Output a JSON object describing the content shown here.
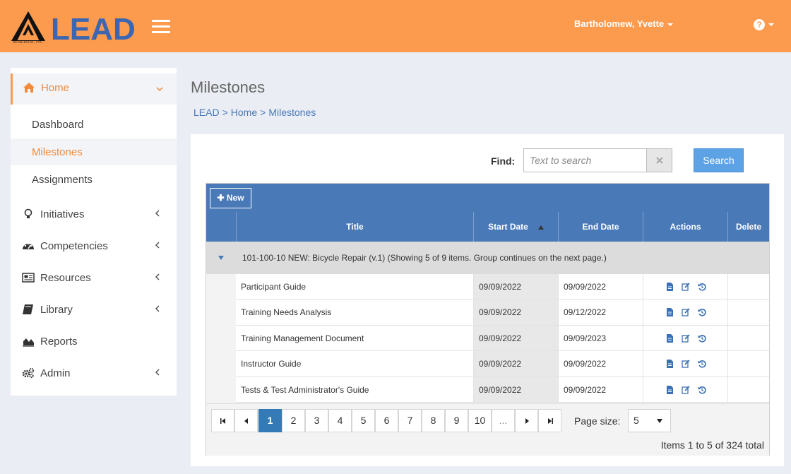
{
  "brand": {
    "logo_text": "LEAD",
    "logo_sub": "AEMERSON, INC."
  },
  "colors": {
    "header_bg": "#fc9a4d",
    "accent": "#f08a3c",
    "grid_header": "#4a79b8",
    "primary_button": "#5ea2e6"
  },
  "header": {
    "user_name": "Bartholomew, Yvette",
    "help_icon": "question-circle-icon"
  },
  "sidebar": {
    "home": {
      "label": "Home",
      "icon": "home-icon"
    },
    "sub_items": [
      {
        "label": "Dashboard"
      },
      {
        "label": "Milestones"
      },
      {
        "label": "Assignments"
      }
    ],
    "items": [
      {
        "label": "Initiatives",
        "icon": "lightbulb-icon"
      },
      {
        "label": "Competencies",
        "icon": "dashboard-icon"
      },
      {
        "label": "Resources",
        "icon": "newspaper-icon"
      },
      {
        "label": "Library",
        "icon": "book-icon"
      },
      {
        "label": "Reports",
        "icon": "area-chart-icon"
      },
      {
        "label": "Admin",
        "icon": "cogs-icon"
      }
    ]
  },
  "main": {
    "title": "Milestones",
    "breadcrumb": [
      "LEAD",
      "Home",
      "Milestones"
    ],
    "find_label": "Find:",
    "search_placeholder": "Text to search",
    "search_button": "Search",
    "new_button": "New",
    "columns": [
      "Title",
      "Start Date",
      "End Date",
      "Actions",
      "Delete"
    ],
    "group_header": "101-100-10 NEW: Bicycle Repair (v.1) (Showing 5 of 9 items. Group continues on the next page.)",
    "rows": [
      {
        "title": "Participant Guide",
        "start": "09/09/2022",
        "end": "09/09/2022"
      },
      {
        "title": "Training Needs Analysis",
        "start": "09/09/2022",
        "end": "09/12/2022"
      },
      {
        "title": "Training Management Document",
        "start": "09/09/2022",
        "end": "09/09/2023"
      },
      {
        "title": "Instructor Guide",
        "start": "09/09/2022",
        "end": "09/09/2022"
      },
      {
        "title": "Tests & Test Administrator's Guide",
        "start": "09/09/2022",
        "end": "09/09/2022"
      }
    ],
    "pager": {
      "pages": [
        "1",
        "2",
        "3",
        "4",
        "5",
        "6",
        "7",
        "8",
        "9",
        "10",
        "..."
      ],
      "current": "1",
      "page_size_label": "Page size:",
      "page_size": "5",
      "info": "Items 1 to 5 of 324 total"
    }
  }
}
